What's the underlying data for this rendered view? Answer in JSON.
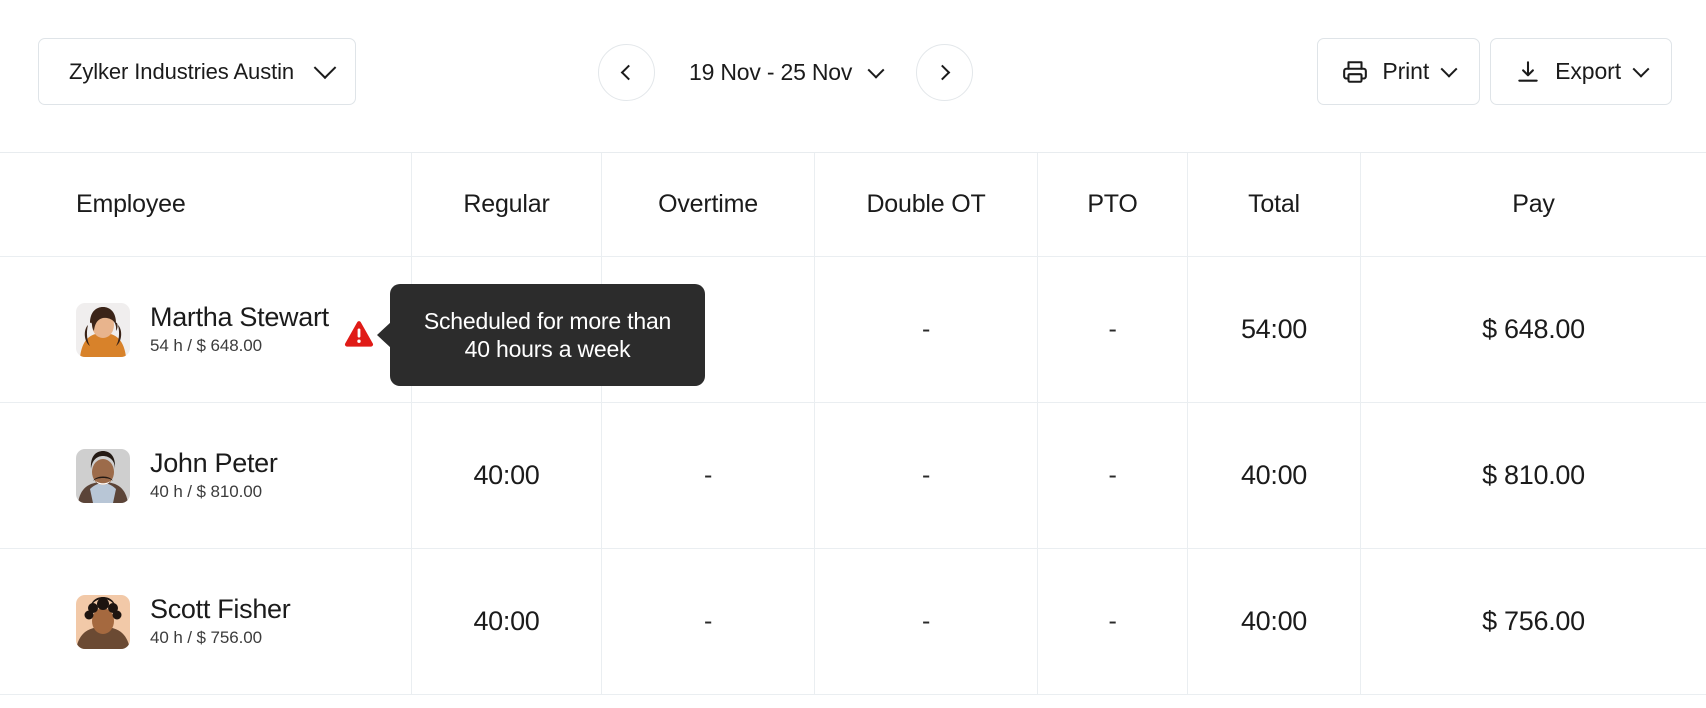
{
  "toolbar": {
    "org_selector": {
      "label": "Zylker Industries Austin",
      "icon": "chevron-down-icon"
    },
    "date_nav": {
      "prev_icon": "chevron-left-icon",
      "next_icon": "chevron-right-icon",
      "range": "19 Nov - 25 Nov",
      "range_icon": "chevron-down-icon"
    },
    "print_button": {
      "label": "Print",
      "icon": "printer-icon",
      "caret": "chevron-down-icon"
    },
    "export_button": {
      "label": "Export",
      "icon": "download-icon",
      "caret": "chevron-down-icon"
    }
  },
  "table": {
    "columns": [
      "Employee",
      "Regular",
      "Overtime",
      "Double OT",
      "PTO",
      "Total",
      "Pay"
    ],
    "rows": [
      {
        "name": "Martha Stewart",
        "sub": "54 h / $ 648.00",
        "avatar_alt": "martha-stewart-avatar",
        "regular": "",
        "overtime": "",
        "double_ot": "-",
        "pto": "-",
        "total": "54:00",
        "pay": "$ 648.00",
        "warning": true
      },
      {
        "name": "John Peter",
        "sub": "40 h / $ 810.00",
        "avatar_alt": "john-peter-avatar",
        "regular": "40:00",
        "overtime": "-",
        "double_ot": "-",
        "pto": "-",
        "total": "40:00",
        "pay": "$ 810.00",
        "warning": false
      },
      {
        "name": "Scott Fisher",
        "sub": "40 h / $ 756.00",
        "avatar_alt": "scott-fisher-avatar",
        "regular": "40:00",
        "overtime": "-",
        "double_ot": "-",
        "pto": "-",
        "total": "40:00",
        "pay": "$ 756.00",
        "warning": false
      }
    ]
  },
  "tooltip": {
    "text": "Scheduled for more than 40 hours a week",
    "background": "#2c2c2c",
    "text_color": "#ffffff"
  },
  "colors": {
    "warning": "#e01b17",
    "border": "#eaeef1",
    "text": "#1b1b1b"
  }
}
